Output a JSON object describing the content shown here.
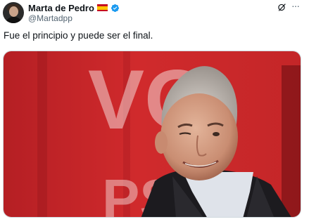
{
  "author": {
    "display_name": "Marta de Pedro",
    "handle": "@Martadpp",
    "flag": "spain-flag",
    "verified": true
  },
  "tweet": {
    "text": "Fue el principio y puede ser el final."
  },
  "actions": {
    "grok": "grok-icon",
    "more": "···"
  },
  "media": {
    "background_text_1": "VO",
    "background_text_2": "PSO",
    "colors": {
      "background_red": "#c8262a",
      "brand_blue": "#1d9bf0"
    }
  }
}
